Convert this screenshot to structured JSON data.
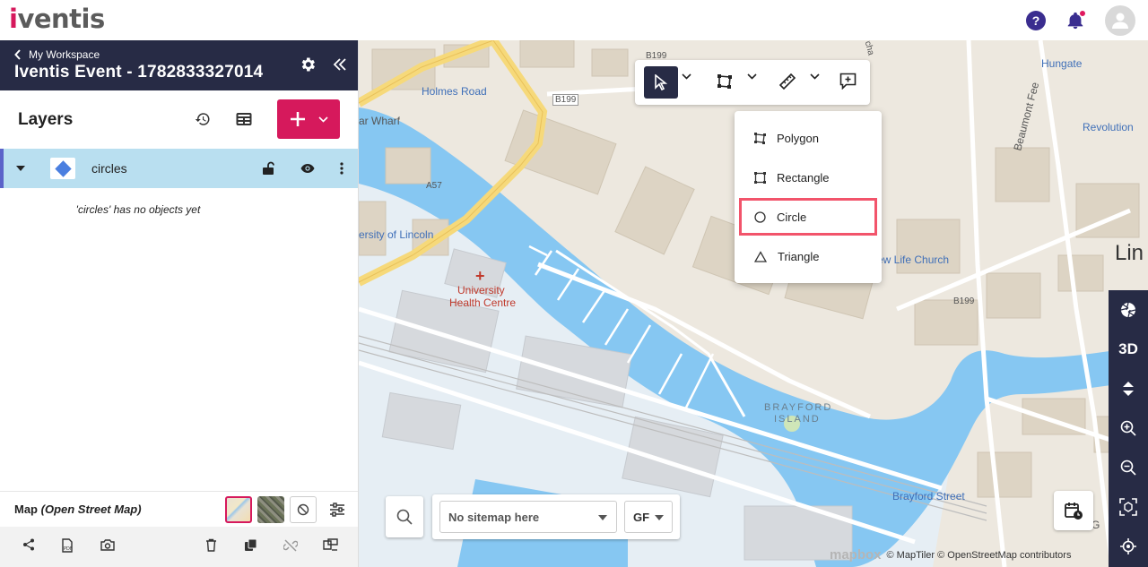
{
  "app": {
    "logo": "iventis"
  },
  "topbar": {
    "help_icon": "help-icon",
    "notification_icon": "bell-icon",
    "avatar_icon": "user-icon"
  },
  "sidebar": {
    "breadcrumb": "My Workspace",
    "event_title": "Iventis Event - 1782833327014",
    "layers_title": "Layers",
    "layer": {
      "name": "circles",
      "color": "#4a7fe0"
    },
    "empty_message": "'circles' has no objects yet",
    "map_label": "Map",
    "map_style": "(Open Street Map)"
  },
  "toolbar": {
    "dropdown_items": [
      "Polygon",
      "Rectangle",
      "Circle",
      "Triangle"
    ],
    "highlighted": "Circle"
  },
  "map": {
    "labels": {
      "holmes_road": "Holmes Road",
      "b199_a": "B199",
      "b199_b": "B199",
      "b199_c": "B199",
      "a57": "A57",
      "wharf": "ar Wharf",
      "univ_lincoln": "ersity of Lincoln",
      "health_centre_1": "University",
      "health_centre_2": "Health Centre",
      "brayford_1": "BRAYFORD",
      "brayford_2": "ISLAND",
      "brayford_street": "Brayford Street",
      "new_life": "ew Life Church",
      "hungate": "Hungate",
      "revolution": "Revolution",
      "beaumont": "Beaumont Fee",
      "lin": "Lin",
      "the_g": "The G",
      "orcha": "Orcha"
    },
    "rail": {
      "three_d": "3D"
    },
    "sitemap_placeholder": "No sitemap here",
    "floor": "GF",
    "attribution": "© MapTiler © OpenStreetMap contributors",
    "mapbox": "mapbox",
    "colors": {
      "water": "#86c7f2",
      "land": "#ede8df",
      "road": "#ffffff",
      "primary": "#f6d97a"
    }
  }
}
